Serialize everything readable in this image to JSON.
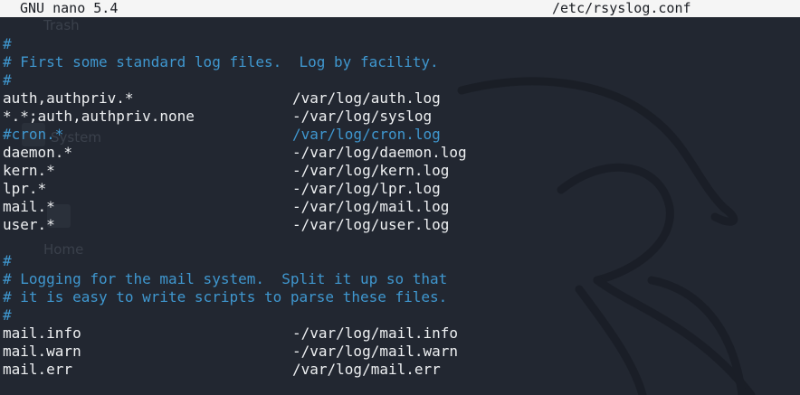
{
  "titlebar": {
    "app": "GNU nano 5.4",
    "file": "/etc/rsyslog.conf"
  },
  "desktop": {
    "ghost_trash": "Trash",
    "ghost_system": "System",
    "ghost_home": "Home"
  },
  "colors": {
    "background": "#222731",
    "comment": "#3f97cf",
    "text": "#eef0f2",
    "titlebar_bg": "#f5f5f5"
  },
  "lines": [
    {
      "type": "comment",
      "text": "#"
    },
    {
      "type": "comment",
      "text": "# First some standard log files.  Log by facility."
    },
    {
      "type": "comment",
      "text": "#"
    },
    {
      "type": "rule",
      "selector": "auth,authpriv.*",
      "action": "/var/log/auth.log"
    },
    {
      "type": "rule",
      "selector": "*.*;auth,authpriv.none",
      "action": "-/var/log/syslog"
    },
    {
      "type": "comment-rule",
      "selector": "#cron.*",
      "action": "/var/log/cron.log"
    },
    {
      "type": "rule",
      "selector": "daemon.*",
      "action": "-/var/log/daemon.log"
    },
    {
      "type": "rule",
      "selector": "kern.*",
      "action": "-/var/log/kern.log"
    },
    {
      "type": "rule",
      "selector": "lpr.*",
      "action": "-/var/log/lpr.log"
    },
    {
      "type": "rule",
      "selector": "mail.*",
      "action": "-/var/log/mail.log"
    },
    {
      "type": "rule",
      "selector": "user.*",
      "action": "-/var/log/user.log"
    },
    {
      "type": "blank",
      "text": ""
    },
    {
      "type": "comment",
      "text": "#"
    },
    {
      "type": "comment",
      "text": "# Logging for the mail system.  Split it up so that"
    },
    {
      "type": "comment",
      "text": "# it is easy to write scripts to parse these files."
    },
    {
      "type": "comment",
      "text": "#"
    },
    {
      "type": "rule",
      "selector": "mail.info",
      "action": "-/var/log/mail.info"
    },
    {
      "type": "rule",
      "selector": "mail.warn",
      "action": "-/var/log/mail.warn"
    },
    {
      "type": "rule",
      "selector": "mail.err",
      "action": "/var/log/mail.err"
    }
  ]
}
